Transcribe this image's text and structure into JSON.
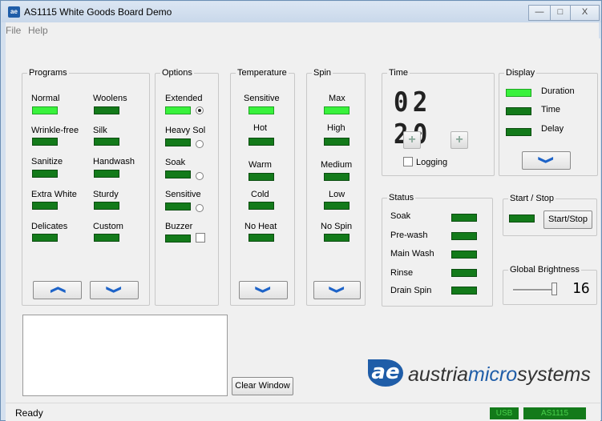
{
  "window": {
    "title": "AS1115 White Goods Board Demo",
    "app_icon": "ae",
    "min": "—",
    "max": "□",
    "close": "X"
  },
  "menu": [
    "File",
    "Help"
  ],
  "programs": {
    "title": "Programs",
    "items": [
      {
        "label": "Normal",
        "on": true
      },
      {
        "label": "Woolens",
        "on": false
      },
      {
        "label": "Wrinkle-free",
        "on": false
      },
      {
        "label": "Silk",
        "on": false
      },
      {
        "label": "Sanitize",
        "on": false
      },
      {
        "label": "Handwash",
        "on": false
      },
      {
        "label": "Extra White",
        "on": false
      },
      {
        "label": "Sturdy",
        "on": false
      },
      {
        "label": "Delicates",
        "on": false
      },
      {
        "label": "Custom",
        "on": false
      }
    ],
    "up_icon": "❯",
    "down_icon": "❯"
  },
  "options": {
    "title": "Options",
    "items": [
      {
        "label": "Extended",
        "on": true,
        "control": "radio",
        "selected": true
      },
      {
        "label": "Heavy Sol",
        "on": false,
        "control": "radio",
        "selected": false
      },
      {
        "label": "Soak",
        "on": false,
        "control": "radio",
        "selected": false
      },
      {
        "label": "Sensitive",
        "on": false,
        "control": "radio",
        "selected": false
      },
      {
        "label": "Buzzer",
        "on": false,
        "control": "checkbox",
        "selected": false
      }
    ]
  },
  "temperature": {
    "title": "Temperature",
    "items": [
      {
        "label": "Sensitive",
        "on": true
      },
      {
        "label": "Hot",
        "on": false
      },
      {
        "label": "Warm",
        "on": false
      },
      {
        "label": "Cold",
        "on": false
      },
      {
        "label": "No Heat",
        "on": false
      }
    ]
  },
  "spin": {
    "title": "Spin",
    "items": [
      {
        "label": "Max",
        "on": true
      },
      {
        "label": "High",
        "on": false
      },
      {
        "label": "Medium",
        "on": false
      },
      {
        "label": "Low",
        "on": false
      },
      {
        "label": "No Spin",
        "on": false
      }
    ]
  },
  "time": {
    "title": "Time",
    "display": "02 20",
    "plus": "+",
    "logging_label": "Logging",
    "logging_checked": false
  },
  "display": {
    "title": "Display",
    "items": [
      {
        "label": "Duration",
        "on": true
      },
      {
        "label": "Time",
        "on": false
      },
      {
        "label": "Delay",
        "on": false
      }
    ]
  },
  "status": {
    "title": "Status",
    "items": [
      {
        "label": "Soak"
      },
      {
        "label": "Pre-wash"
      },
      {
        "label": "Main Wash"
      },
      {
        "label": "Rinse"
      },
      {
        "label": "Drain Spin"
      }
    ]
  },
  "start_stop": {
    "title": "Start / Stop",
    "button": "Start/Stop"
  },
  "brightness": {
    "title": "Global Brightness",
    "value": "16"
  },
  "clear_button": "Clear Window",
  "logo": {
    "mark": "ae",
    "text_a": "austria",
    "text_b": "micro",
    "text_c": "systems"
  },
  "statusbar": {
    "text": "Ready",
    "usb": "USB",
    "device": "AS1115"
  },
  "colors": {
    "led_on": "#39f23c",
    "led_off": "#137a1a",
    "accent": "#1f5da8"
  }
}
